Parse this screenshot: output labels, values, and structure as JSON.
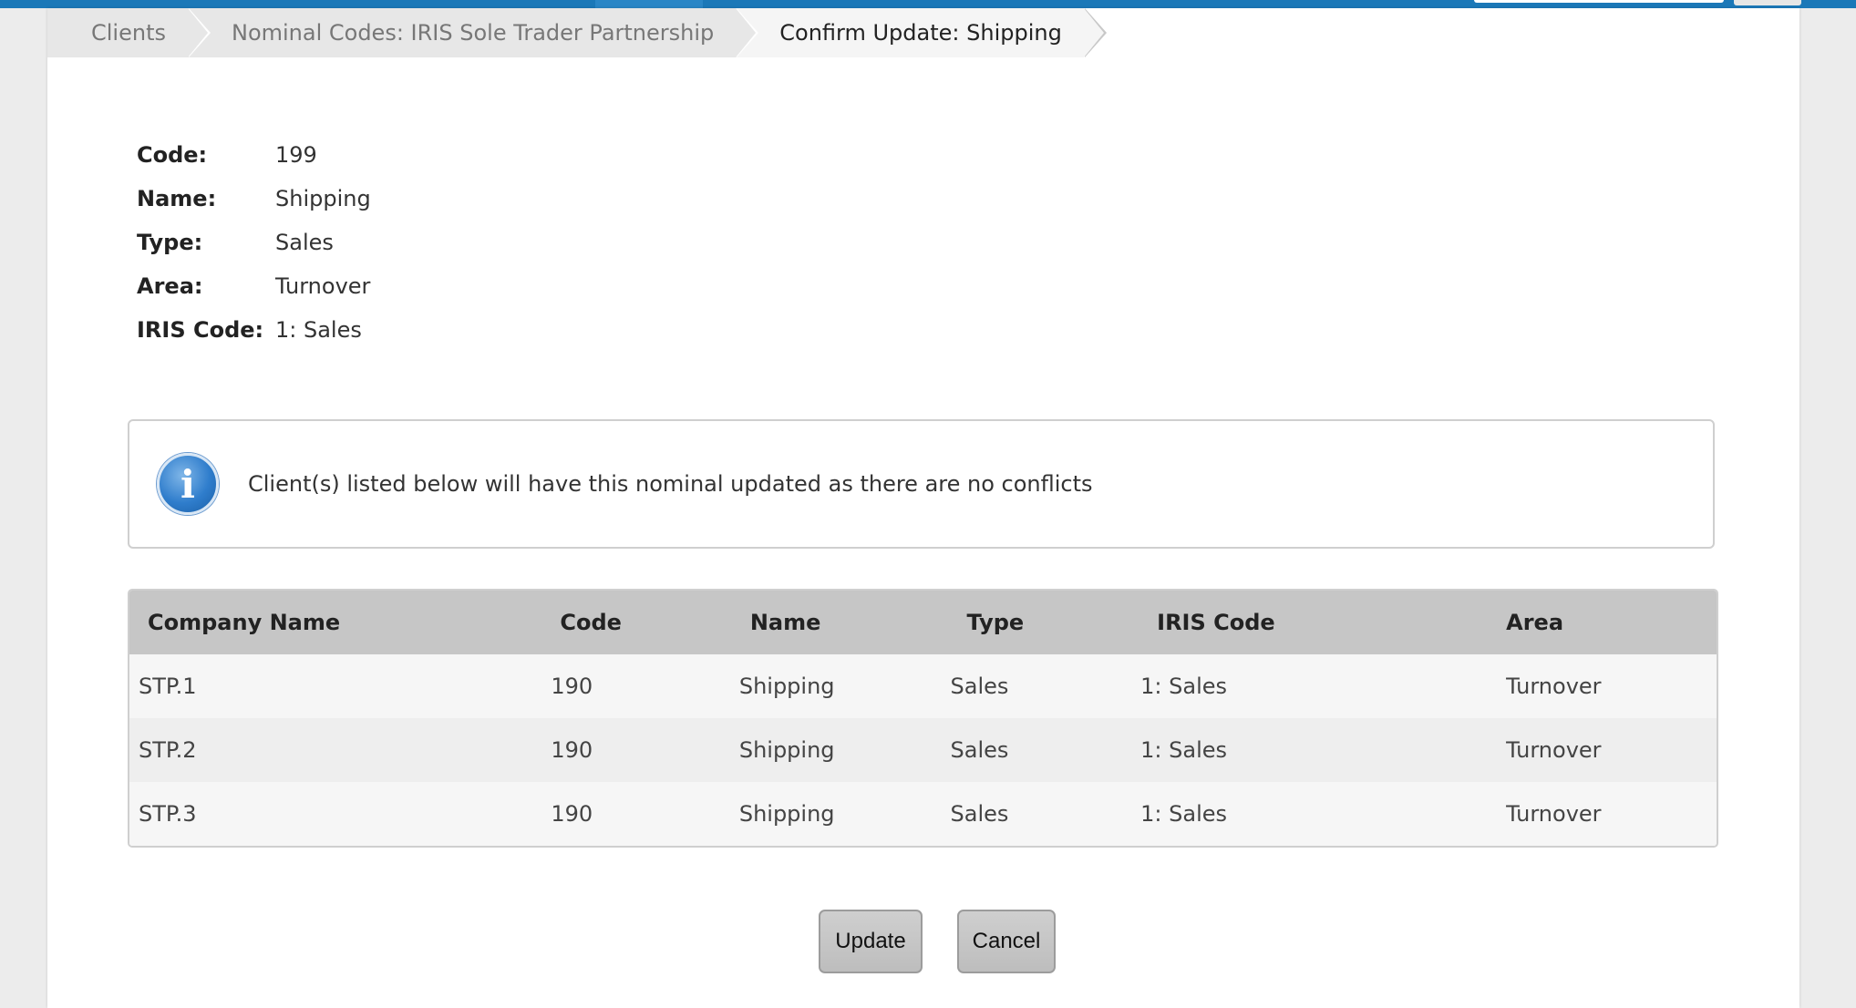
{
  "breadcrumb": [
    {
      "label": "Clients"
    },
    {
      "label": "Nominal Codes: IRIS Sole Trader Partnership"
    },
    {
      "label": "Confirm Update: Shipping"
    }
  ],
  "details": [
    {
      "label": "Code:",
      "value": "199"
    },
    {
      "label": "Name:",
      "value": "Shipping"
    },
    {
      "label": "Type:",
      "value": "Sales"
    },
    {
      "label": "Area:",
      "value": "Turnover"
    },
    {
      "label": "IRIS Code:",
      "value": "1: Sales"
    }
  ],
  "info": {
    "icon": "info-icon",
    "glyph": "i",
    "message": "Client(s) listed below will have this nominal updated as there are no conflicts"
  },
  "table": {
    "headers": [
      "Company Name",
      "Code",
      "Name",
      "Type",
      "IRIS Code",
      "Area"
    ],
    "rows": [
      [
        "STP.1",
        "190",
        "Shipping",
        "Sales",
        "1: Sales",
        "Turnover"
      ],
      [
        "STP.2",
        "190",
        "Shipping",
        "Sales",
        "1: Sales",
        "Turnover"
      ],
      [
        "STP.3",
        "190",
        "Shipping",
        "Sales",
        "1: Sales",
        "Turnover"
      ]
    ]
  },
  "buttons": {
    "update_label": "Update",
    "cancel_label": "Cancel"
  },
  "colors": {
    "topbar": "#1b78b8",
    "header_bg": "#c6c6c6",
    "info_icon": "#2f7dcc"
  }
}
